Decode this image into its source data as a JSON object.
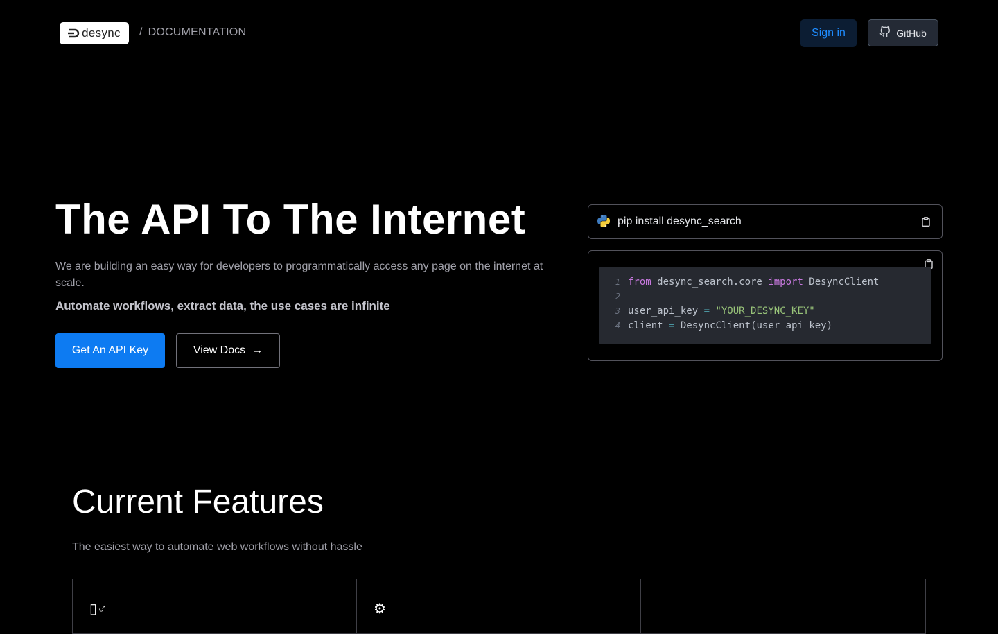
{
  "header": {
    "logo_text": "desync",
    "breadcrumb_separator": "/",
    "breadcrumb": "DOCUMENTATION",
    "signin_label": "Sign in",
    "github_label": "GitHub"
  },
  "hero": {
    "title": "The API To The Internet",
    "subtitle": "We are building an easy way for developers to programmatically access any page on the internet at scale.",
    "tagline": "Automate workflows, extract data, the use cases are infinite",
    "primary_button": "Get An API Key",
    "secondary_button": "View Docs",
    "secondary_arrow": "→"
  },
  "install": {
    "command": "pip install desync_search"
  },
  "code": {
    "line_numbers": [
      "1",
      "2",
      "3",
      "4"
    ],
    "l1_kw1": "from",
    "l1_mod": " desync_search.core ",
    "l1_kw2": "import",
    "l1_cls": " DesyncClient",
    "l3_var": "user_api_key ",
    "l3_op": "=",
    "l3_str": " \"YOUR_DESYNC_KEY\"",
    "l4_var": "client ",
    "l4_op": "=",
    "l4_call": " DesyncClient(user_api_key)"
  },
  "features": {
    "title": "Current Features",
    "subtitle": "The easiest way to automate web workflows without hassle",
    "cells": [
      {
        "icon": "▯♂"
      },
      {
        "icon": "⚙"
      },
      {
        "icon": ""
      }
    ]
  },
  "colors": {
    "accent": "#0d7bf2",
    "signin_text": "#1e8cff",
    "background": "#000000"
  },
  "icons": [
    "python-icon",
    "copy-icon",
    "github-icon",
    "gear-icon"
  ]
}
